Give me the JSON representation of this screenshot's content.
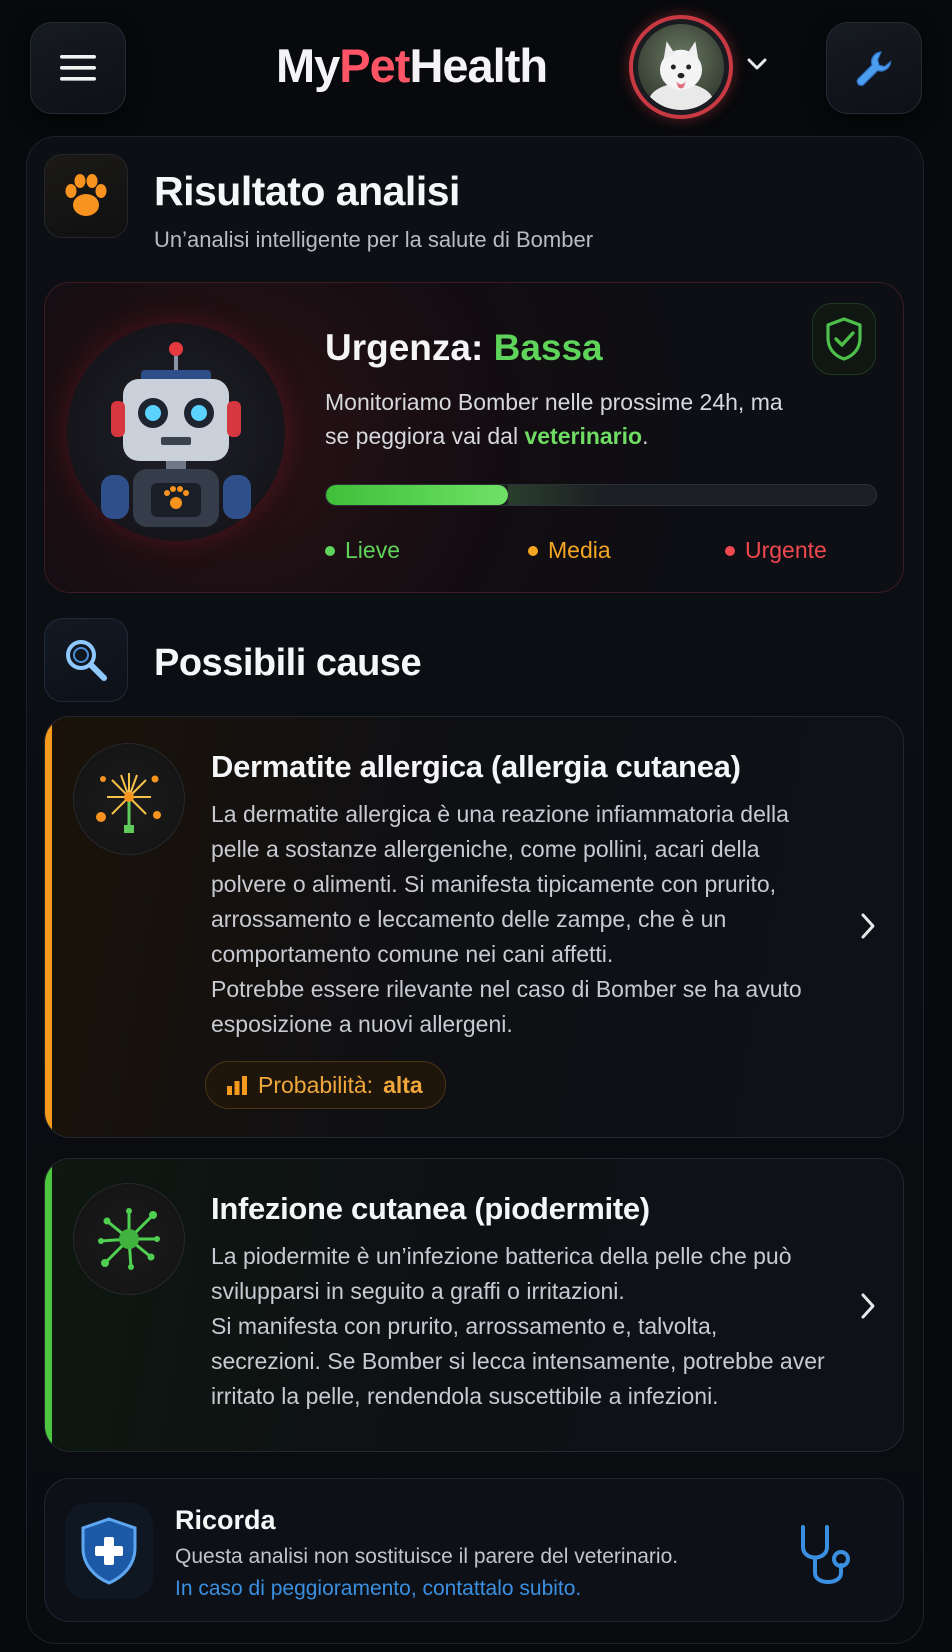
{
  "app": {
    "brand_prefix": "My",
    "brand_accent": "Pet",
    "brand_suffix": "Health"
  },
  "header": {
    "menu_icon": "menu-icon",
    "settings_icon": "wrench-icon",
    "avatar_icon": "dog-avatar",
    "chevron_icon": "chevron-down-icon"
  },
  "result": {
    "title": "Risultato analisi",
    "subtitle": "Un’analisi intelligente per la salute di Bomber"
  },
  "urgency": {
    "label": "Urgenza:",
    "level": "Bassa",
    "text_before": "Monitoriamo Bomber nelle prossime 24h, ma se peggiora vai dal ",
    "text_highlight": "veterinario",
    "text_after": ".",
    "level_fraction": 0.33,
    "legend": [
      {
        "label": "Lieve",
        "color": "#5fd45a"
      },
      {
        "label": "Media",
        "color": "#f5a623"
      },
      {
        "label": "Urgente",
        "color": "#f0484f"
      }
    ]
  },
  "causes_section": {
    "title": "Possibili cause"
  },
  "causes": [
    {
      "title": "Dermatite allergica (allergia cutanea)",
      "paragraphs": [
        "La dermatite allergica è una reazione infiammatoria della pelle a sostanze allergeniche, come pollini, acari della polvere o alimenti. Si manifesta tipicamente con prurito, arrossamento e leccamento delle zampe, che è un comportamento comune nei cani affetti.",
        "Potrebbe essere rilevante nel caso di Bomber se ha avuto esposizione a nuovi allergeni."
      ],
      "probability_label": "Probabilità:",
      "probability_value": "alta",
      "accent": "#f59a1c"
    },
    {
      "title": "Infezione cutanea (piodermite)",
      "paragraphs": [
        "La piodermite è un’infezione batterica della pelle che può svilupparsi in seguito a graffi o irritazioni.",
        "Si manifesta con prurito, arrossamento e, talvolta, secrezioni. Se Bomber si lecca intensamente, potrebbe aver irritato la pelle, rendendola suscettibile a infezioni."
      ],
      "accent": "#4cc63f"
    }
  ],
  "reminder": {
    "title": "Ricorda",
    "text": "Questa analisi non sostituisce il parere del veterinario.",
    "link": "In caso di peggioramento, contattalo subito."
  }
}
